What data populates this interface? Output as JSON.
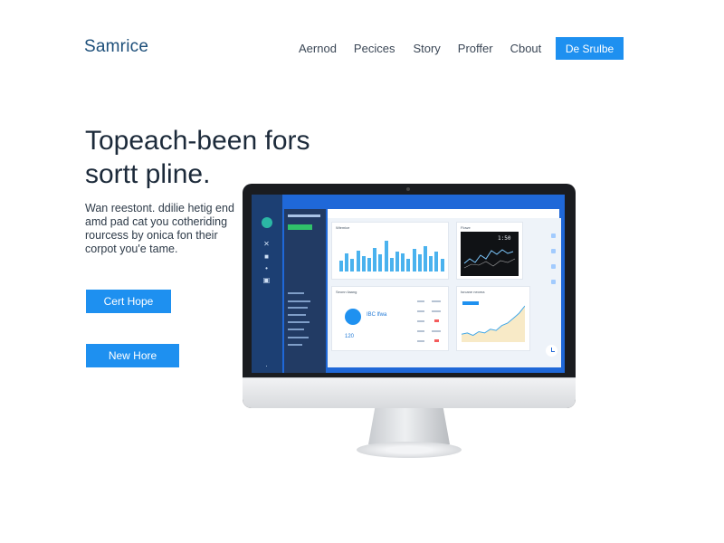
{
  "brand": {
    "logo": "Samrice"
  },
  "nav": {
    "items": [
      "Aernod",
      "Pecices",
      "Story",
      "Proffer",
      "Cbout"
    ]
  },
  "header_cta": {
    "label": "De Srulbe"
  },
  "hero": {
    "title": "Topeach-been fors sortt pline.",
    "subtitle": "Wan reestont. ddilie hetig end amd pad cat you cotheriding rourcess by onica fon their corpot you'e tame.",
    "button_primary": "Cert Hope",
    "button_secondary": "New Hore"
  },
  "dashboard": {
    "card_titles": [
      "Wiemice",
      "Flowe",
      "Seonn liaang",
      "Isrcane neoma"
    ],
    "metric_label": "IBC lfwa",
    "metric_value": "120",
    "chart_data": {
      "type": "bar",
      "values": [
        8,
        13,
        9,
        15,
        11,
        10,
        17,
        12,
        22,
        10,
        14,
        13,
        9,
        16,
        12,
        18,
        11,
        14,
        9
      ]
    },
    "line_data": [
      5,
      6,
      4,
      7,
      6,
      9,
      8,
      12,
      14,
      18,
      22,
      28
    ],
    "dark_card": {
      "value": "1:50"
    }
  },
  "colors": {
    "accent": "#1e90f0",
    "screen_blue": "#1f68d8",
    "sidebar": "#1c3f73"
  }
}
